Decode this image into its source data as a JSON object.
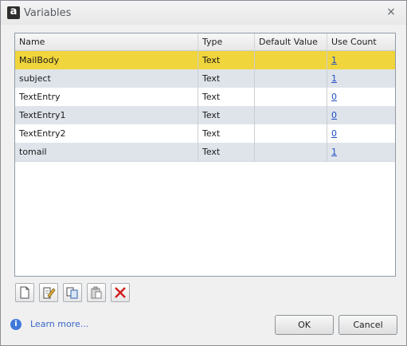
{
  "window": {
    "title": "Variables",
    "app_icon": "a",
    "close": "×"
  },
  "grid": {
    "columns": [
      "Name",
      "Type",
      "Default Value",
      "Use Count"
    ],
    "rows": [
      {
        "name": "MailBody",
        "type": "Text",
        "default": "",
        "use_count": "1",
        "selected": true
      },
      {
        "name": "subject",
        "type": "Text",
        "default": "",
        "use_count": "1"
      },
      {
        "name": "TextEntry",
        "type": "Text",
        "default": "",
        "use_count": "0"
      },
      {
        "name": "TextEntry1",
        "type": "Text",
        "default": "",
        "use_count": "0"
      },
      {
        "name": "TextEntry2",
        "type": "Text",
        "default": "",
        "use_count": "0"
      },
      {
        "name": "tomail",
        "type": "Text",
        "default": "",
        "use_count": "1"
      }
    ]
  },
  "toolbar": {
    "icons": [
      "new-icon",
      "edit-icon",
      "copy-icon",
      "paste-icon",
      "delete-icon"
    ],
    "delete_color": "#d11e1e"
  },
  "footer": {
    "info_icon": "i",
    "learn_more": "Learn more...",
    "ok_label": "OK",
    "cancel_label": "Cancel"
  },
  "colors": {
    "selected_row": "#f1d53c",
    "alt_row": "#dfe4ea",
    "link": "#1f4fc7"
  }
}
